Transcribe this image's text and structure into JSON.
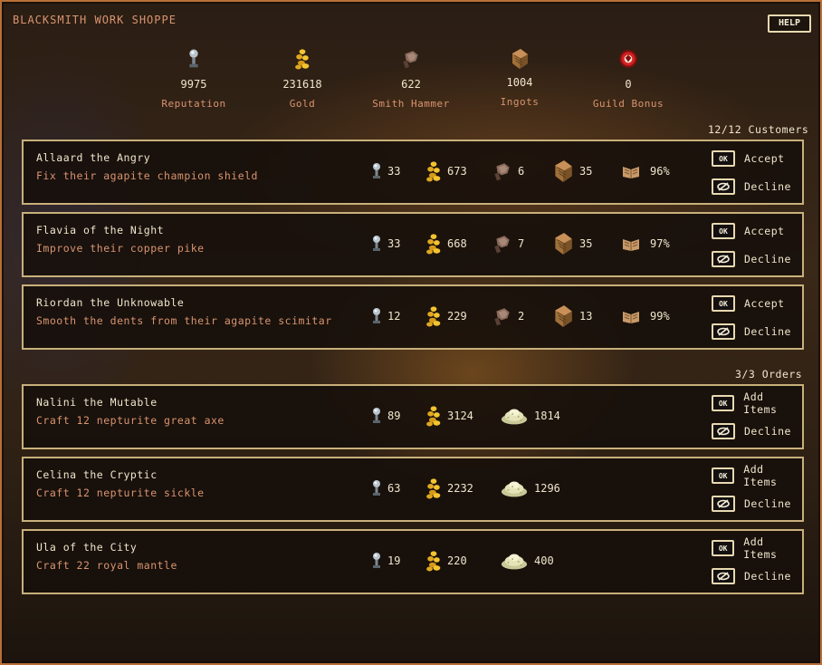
{
  "window": {
    "title": "BLACKSMITH WORK SHOPPE",
    "help_label": "HELP"
  },
  "stats": [
    {
      "icon": "reputation-icon",
      "value": "9975",
      "label": "Reputation"
    },
    {
      "icon": "gold-icon",
      "value": "231618",
      "label": "Gold"
    },
    {
      "icon": "smith-hammer-icon",
      "value": "622",
      "label": "Smith Hammer"
    },
    {
      "icon": "ingot-icon",
      "value": "1004",
      "label": "Ingots"
    },
    {
      "icon": "guild-bonus-icon",
      "value": "0",
      "label": "Guild Bonus"
    }
  ],
  "customers": {
    "count_label": "12/12 Customers",
    "accept_label": "Accept",
    "decline_label": "Decline",
    "ok_glyph": "OK",
    "items": [
      {
        "name": "Allaard the Angry",
        "task": "Fix their agapite champion shield",
        "reputation": "33",
        "gold": "673",
        "hammer": "6",
        "ingots": "35",
        "chance": "96%"
      },
      {
        "name": "Flavia of the Night",
        "task": "Improve their copper pike",
        "reputation": "33",
        "gold": "668",
        "hammer": "7",
        "ingots": "35",
        "chance": "97%"
      },
      {
        "name": "Riordan the Unknowable",
        "task": "Smooth the dents from their agapite scimitar",
        "reputation": "12",
        "gold": "229",
        "hammer": "2",
        "ingots": "13",
        "chance": "99%"
      }
    ]
  },
  "orders": {
    "count_label": "3/3 Orders",
    "add_label": "Add Items",
    "decline_label": "Decline",
    "ok_glyph": "OK",
    "items": [
      {
        "name": "Nalini the Mutable",
        "task": "Craft 12 nepturite great axe",
        "reputation": "89",
        "gold": "3124",
        "pile": "1814"
      },
      {
        "name": "Celina the Cryptic",
        "task": "Craft 12 nepturite sickle",
        "reputation": "63",
        "gold": "2232",
        "pile": "1296"
      },
      {
        "name": "Ula of the City",
        "task": "Craft 22 royal mantle",
        "reputation": "19",
        "gold": "220",
        "pile": "400"
      }
    ]
  },
  "colors": {
    "accent": "#d99470",
    "border": "#c8b07a",
    "frame": "#b86f37",
    "text": "#f0e6cc"
  }
}
